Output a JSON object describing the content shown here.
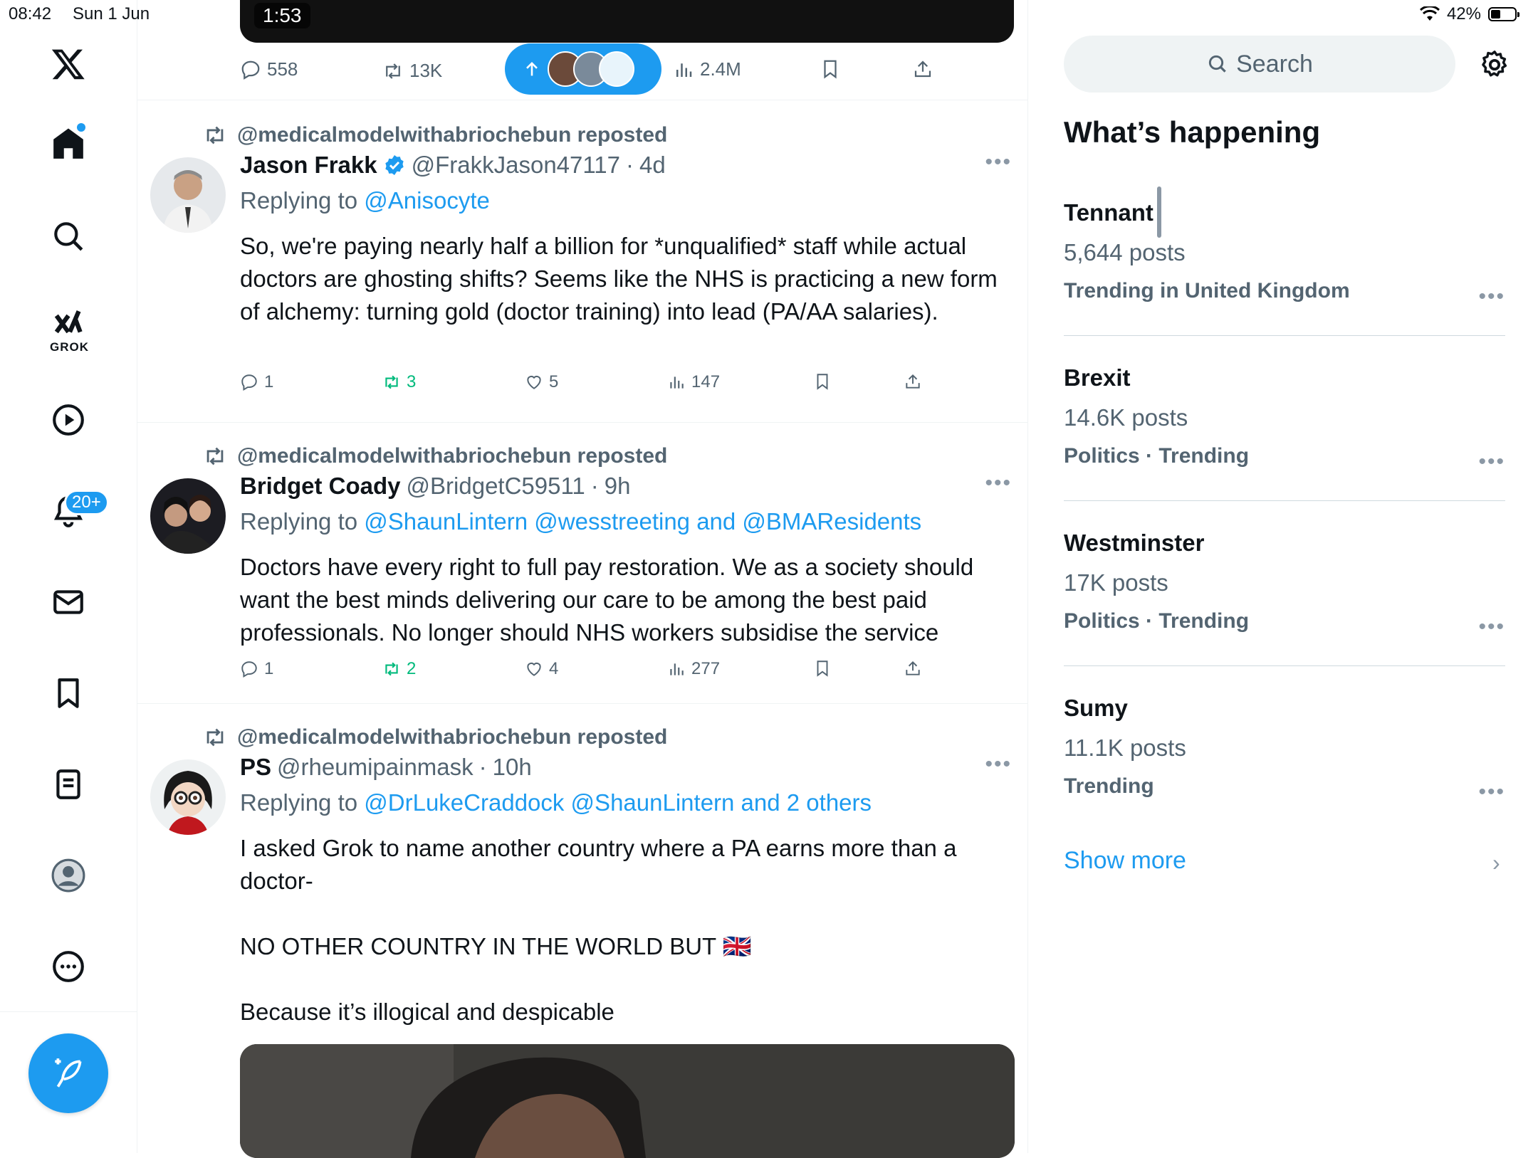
{
  "status_bar": {
    "time": "08:42",
    "date": "Sun 1 Jun",
    "battery": "42%",
    "battery_level": 0.42
  },
  "nav": {
    "grok_label": "GROK",
    "notifications_badge": "20+"
  },
  "top_post": {
    "video_time": "1:53",
    "replies": "558",
    "reposts": "13K",
    "views": "2.4M"
  },
  "tweets": [
    {
      "repost_by": "@medicalmodelwithabriochebun reposted",
      "name": "Jason Frakk",
      "handle": "@FrakkJason47117",
      "age": "4d",
      "replying_prefix": "Replying to",
      "replying_to": "@Anisocyte",
      "body": "So, we're paying nearly half a billion for *unqualified* staff while actual doctors are ghosting shifts? Seems like the NHS is practicing a new form of alchemy: turning gold (doctor training) into lead (PA/AA salaries).",
      "replies": "1",
      "reposts": "3",
      "likes": "5",
      "views": "147"
    },
    {
      "repost_by": "@medicalmodelwithabriochebun reposted",
      "name": "Bridget Coady",
      "handle": "@BridgetC59511",
      "age": "9h",
      "replying_prefix": "Replying to",
      "replying_to": "@ShaunLintern @wesstreeting and @BMAResidents",
      "body": "Doctors have every right to full pay restoration. We as a society should want the best minds delivering our care to be among the best paid professionals. No longer should NHS workers subsidise the service",
      "replies": "1",
      "reposts": "2",
      "likes": "4",
      "views": "277"
    },
    {
      "repost_by": "@medicalmodelwithabriochebun reposted",
      "name": "PS",
      "handle": "@rheumipainmask",
      "age": "10h",
      "replying_prefix": "Replying to",
      "replying_to": "@DrLukeCraddock @ShaunLintern and 2 others",
      "body": "I asked Grok to name another country where a PA earns more than a doctor-\n\nNO OTHER COUNTRY IN THE WORLD BUT 🇬🇧\n\nBecause it’s illogical and despicable"
    }
  ],
  "right": {
    "search_placeholder": "Search",
    "heading": "What’s happening",
    "trends": [
      {
        "name": "Tennant",
        "count": "5,644 posts",
        "context": "Trending in United Kingdom"
      },
      {
        "name": "Brexit",
        "count": "14.6K posts",
        "context": "Politics · Trending"
      },
      {
        "name": "Westminster",
        "count": "17K posts",
        "context": "Politics · Trending"
      },
      {
        "name": "Sumy",
        "count": "11.1K posts",
        "context": "Trending"
      }
    ],
    "show_more": "Show more"
  },
  "colors": {
    "accent": "#1d9bf0",
    "secondary_text": "#536471",
    "repost_green": "#00ba7c"
  }
}
